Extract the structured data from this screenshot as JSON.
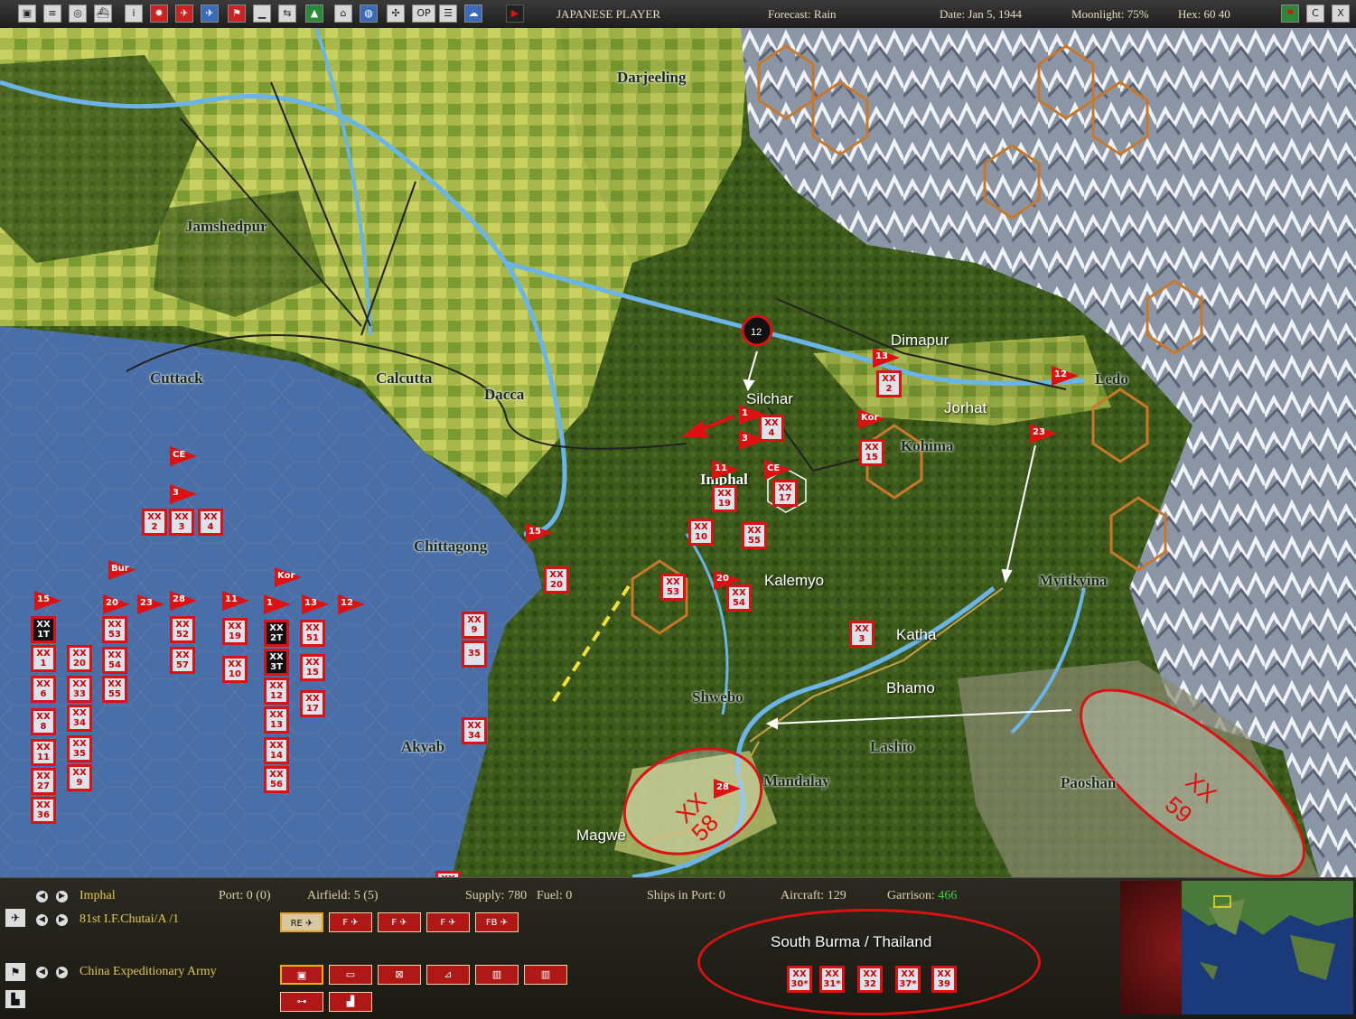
{
  "topbar": {
    "icons": [
      "save-icon",
      "report-icon",
      "map-icon",
      "ship-icon",
      "info-icon",
      "japan-flag-icon",
      "air-icon",
      "plane-icon",
      "flag-icon",
      "ground-icon",
      "path-icon",
      "terrain-icon",
      "base-icon",
      "globe-icon",
      "network-icon",
      "ops-icon",
      "list-icon",
      "weather-icon",
      "play-turn-icon"
    ],
    "ops_label": "OP",
    "player": "JAPANESE PLAYER",
    "forecast": "Forecast: Rain",
    "date": "Date: Jan 5, 1944",
    "moonlight": "Moonlight: 75%",
    "hex": "Hex: 60 40",
    "right_icons": [
      "flag-marker-icon",
      "center-icon",
      "close-icon"
    ],
    "right_labels": [
      "C",
      "X"
    ]
  },
  "map": {
    "places": [
      {
        "id": "darjeeling",
        "name": "Darjeeling"
      },
      {
        "id": "jamshedpur",
        "name": "Jamshedpur"
      },
      {
        "id": "cuttack",
        "name": "Cuttack"
      },
      {
        "id": "calcutta",
        "name": "Calcutta"
      },
      {
        "id": "dacca",
        "name": "Dacca"
      },
      {
        "id": "chittagong",
        "name": "Chittagong"
      },
      {
        "id": "akyab",
        "name": "Akyab"
      },
      {
        "id": "shwebo",
        "name": "Shwebo"
      },
      {
        "id": "lashio",
        "name": "Lashio"
      },
      {
        "id": "mandalay",
        "name": "Mandalay"
      },
      {
        "id": "paoshan",
        "name": "Paoshan"
      },
      {
        "id": "imphal",
        "name": "Imphal"
      }
    ],
    "annotations": [
      {
        "id": "silchar",
        "name": "Silchar"
      },
      {
        "id": "dimapur",
        "name": "Dimapur"
      },
      {
        "id": "jorhat",
        "name": "Jorhat"
      },
      {
        "id": "kohima",
        "name": "Kohima"
      },
      {
        "id": "ledo",
        "name": "Ledo"
      },
      {
        "id": "kalemyo",
        "name": "Kalemyo"
      },
      {
        "id": "myitkyina",
        "name": "Myitkyina"
      },
      {
        "id": "katha",
        "name": "Katha"
      },
      {
        "id": "bhamo",
        "name": "Bhamo"
      },
      {
        "id": "magwe",
        "name": "Magwe"
      }
    ],
    "big_labels": {
      "xx58": "XX",
      "n58": "58",
      "xx59": "XX",
      "n59": "59"
    },
    "flags": [
      {
        "id": "f-ce-left",
        "label": "CE"
      },
      {
        "id": "f-3-left",
        "label": "3"
      },
      {
        "id": "f-bur",
        "label": "Bur"
      },
      {
        "id": "f-kor-left",
        "label": "Kor"
      },
      {
        "id": "f-15a",
        "label": "15"
      },
      {
        "id": "f-20",
        "label": "20"
      },
      {
        "id": "f-23",
        "label": "23"
      },
      {
        "id": "f-28a",
        "label": "28"
      },
      {
        "id": "f-11a",
        "label": "11"
      },
      {
        "id": "f-1a",
        "label": "1"
      },
      {
        "id": "f-13a",
        "label": "13"
      },
      {
        "id": "f-12a",
        "label": "12"
      },
      {
        "id": "f-15b",
        "label": "15"
      },
      {
        "id": "f-1b",
        "label": "1"
      },
      {
        "id": "f-3b",
        "label": "3"
      },
      {
        "id": "f-11b",
        "label": "11"
      },
      {
        "id": "f-ce-b",
        "label": "CE"
      },
      {
        "id": "f-20b",
        "label": "20"
      },
      {
        "id": "f-kor-b",
        "label": "Kor"
      },
      {
        "id": "f-13b",
        "label": "13"
      },
      {
        "id": "f-12b",
        "label": "12"
      },
      {
        "id": "f-23b",
        "label": "23"
      },
      {
        "id": "f-28b",
        "label": "28"
      }
    ],
    "units": [
      {
        "id": "u-l-2",
        "t": "XX",
        "n": "2"
      },
      {
        "id": "u-l-3",
        "t": "XX",
        "n": "3"
      },
      {
        "id": "u-l-4",
        "t": "XX",
        "n": "4"
      },
      {
        "id": "u-1t",
        "t": "XX",
        "n": "1T"
      },
      {
        "id": "u-1",
        "t": "XX",
        "n": "1"
      },
      {
        "id": "u-6",
        "t": "XX",
        "n": "6"
      },
      {
        "id": "u-8",
        "t": "XX",
        "n": "8"
      },
      {
        "id": "u-11",
        "t": "XX",
        "n": "11"
      },
      {
        "id": "u-27",
        "t": "XX",
        "n": "27"
      },
      {
        "id": "u-36",
        "t": "XX",
        "n": "36"
      },
      {
        "id": "u-20",
        "t": "XX",
        "n": "20"
      },
      {
        "id": "u-33",
        "t": "XX",
        "n": "33"
      },
      {
        "id": "u-34",
        "t": "XX",
        "n": "34"
      },
      {
        "id": "u-35",
        "t": "XX",
        "n": "35"
      },
      {
        "id": "u-9",
        "t": "XX",
        "n": "9"
      },
      {
        "id": "u-53",
        "t": "XX",
        "n": "53"
      },
      {
        "id": "u-54",
        "t": "XX",
        "n": "54"
      },
      {
        "id": "u-55",
        "t": "XX",
        "n": "55"
      },
      {
        "id": "u-52",
        "t": "XX",
        "n": "52"
      },
      {
        "id": "u-57",
        "t": "XX",
        "n": "57"
      },
      {
        "id": "u-19",
        "t": "XX",
        "n": "19"
      },
      {
        "id": "u-10",
        "t": "XX",
        "n": "10"
      },
      {
        "id": "u-2t",
        "t": "XX",
        "n": "2T"
      },
      {
        "id": "u-3t",
        "t": "XX",
        "n": "3T"
      },
      {
        "id": "u-12",
        "t": "XX",
        "n": "12"
      },
      {
        "id": "u-13",
        "t": "XX",
        "n": "13"
      },
      {
        "id": "u-14",
        "t": "XX",
        "n": "14"
      },
      {
        "id": "u-56",
        "t": "XX",
        "n": "56"
      },
      {
        "id": "u-51",
        "t": "XX",
        "n": "51"
      },
      {
        "id": "u-15",
        "t": "XX",
        "n": "15"
      },
      {
        "id": "u-17",
        "t": "XX",
        "n": "17"
      },
      {
        "id": "m-9",
        "t": "XX",
        "n": "9"
      },
      {
        "id": "m-35",
        "t": "35",
        "n": ""
      },
      {
        "id": "m-34",
        "t": "XX",
        "n": "34"
      },
      {
        "id": "m-20",
        "t": "XX",
        "n": "20"
      },
      {
        "id": "m-4",
        "t": "XX",
        "n": "4"
      },
      {
        "id": "m-2",
        "t": "XX",
        "n": "2"
      },
      {
        "id": "m-19",
        "t": "XX",
        "n": "19"
      },
      {
        "id": "m-17",
        "t": "XX",
        "n": "17"
      },
      {
        "id": "m-10",
        "t": "XX",
        "n": "10"
      },
      {
        "id": "m-55",
        "t": "XX",
        "n": "55"
      },
      {
        "id": "m-53",
        "t": "XX",
        "n": "53"
      },
      {
        "id": "m-54",
        "t": "XX",
        "n": "54"
      },
      {
        "id": "m-15",
        "t": "XX",
        "n": "15"
      },
      {
        "id": "m-3",
        "t": "XX",
        "n": "3"
      },
      {
        "id": "m-33",
        "t": "XX",
        "n": "33"
      }
    ],
    "hq_marker": "12"
  },
  "bottombar": {
    "base_name": "Imphal",
    "port": "Port: 0 (0)",
    "airfield": "Airfield: 5 (5)",
    "supply": "Supply: 780",
    "fuel": "Fuel: 0",
    "ships": "Ships in Port: 0",
    "aircraft": "Aircraft: 129",
    "garrison_label": "Garrison:",
    "garrison_value": "466",
    "air_group": "81st I.F.Chutai/A /1",
    "hq": "China Expeditionary Army",
    "plane_buttons": [
      "RE",
      "F",
      "F",
      "F",
      "FB"
    ],
    "south_title": "South Burma / Thailand",
    "south_units": [
      {
        "t": "XX",
        "n": "30*"
      },
      {
        "t": "XX",
        "n": "31*"
      },
      {
        "t": "XX",
        "n": "32"
      },
      {
        "t": "XX",
        "n": "37*"
      },
      {
        "t": "XX",
        "n": "39"
      }
    ]
  },
  "colors": {
    "unit_border": "#d11",
    "unit_bg": "#dde3ea",
    "sea": "#4a6ea8",
    "land": "#3a5a1e",
    "mountain": "#b8c0cc",
    "hex_border": "#c8782a"
  }
}
